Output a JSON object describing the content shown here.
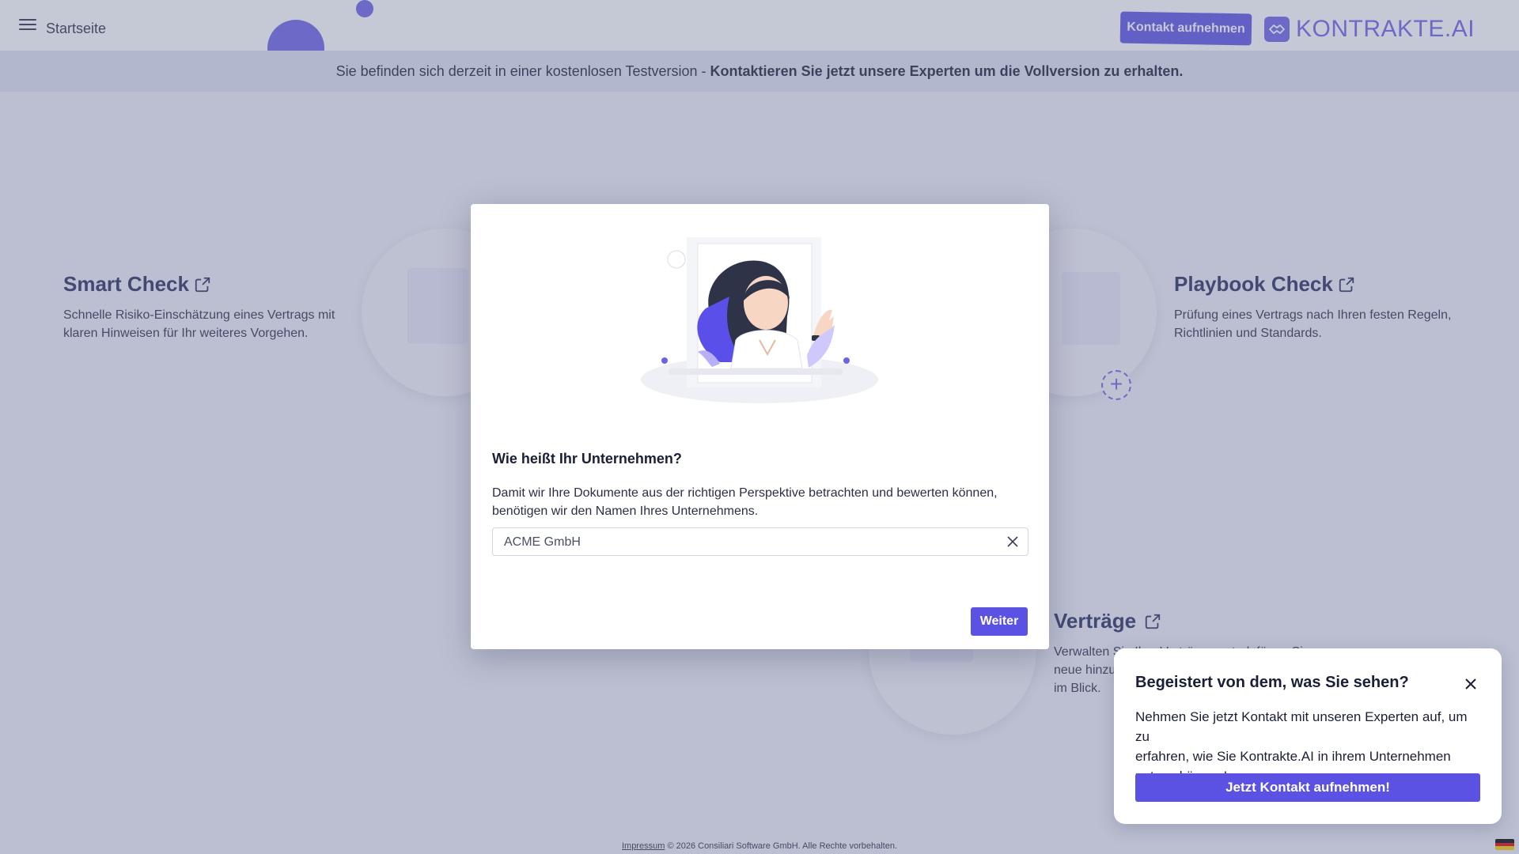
{
  "header": {
    "home_label": "Startseite",
    "contact_button": "Kontakt aufnehmen",
    "logo_text": "KONTRAKTE.AI"
  },
  "banner": {
    "text": "Sie befinden sich derzeit in einer kostenlosen Testversion - ",
    "bold_text": "Kontaktieren Sie jetzt unsere Experten um die Vollversion zu erhalten."
  },
  "features": {
    "smart_check": {
      "title": "Smart Check",
      "desc_line1": "Schnelle Risiko-Einschätzung eines Vertrags mit",
      "desc_line2": "klaren Hinweisen für Ihr weiteres Vorgehen."
    },
    "playbook_check": {
      "title": "Playbook Check",
      "desc_line1": "Prüfung eines Vertrags nach Ihren festen Regeln,",
      "desc_line2": "Richtlinien und Standards."
    },
    "vertraege": {
      "title": "Verträge",
      "desc_line1": "Verwalten Sie Ihre Verträge zentral, fügen Sie",
      "desc_line2": "neue hinzu",
      "desc_line3": "im Blick."
    }
  },
  "modal": {
    "title": "Wie heißt Ihr Unternehmen?",
    "desc_line1": "Damit wir Ihre Dokumente aus der richtigen Perspektive betrachten und bewerten können,",
    "desc_line2": "benötigen wir den Namen Ihres Unternehmens.",
    "company_value": "ACME GmbH",
    "next_button": "Weiter"
  },
  "toast": {
    "title": "Begeistert von dem, was Sie sehen?",
    "text_line1": "Nehmen Sie jetzt Kontakt mit unseren Experten auf, um zu",
    "text_line2": "erfahren, wie Sie Kontrakte.AI in ihrem Unternehmen",
    "text_line3": "nutzen können!",
    "cta_button": "Jetzt Kontakt aufnehmen!"
  },
  "footer": {
    "impressum": "Impressum",
    "copyright": "© 2026 Consiliari Software GmbH. Alle Rechte vorbehalten."
  },
  "colors": {
    "accent": "#5b52e4",
    "brand": "#6b63e6",
    "title": "#262c5c"
  },
  "icons": {
    "menu": "menu-icon",
    "logo": "handshake-icon",
    "external": "external-link-icon",
    "close": "close-icon",
    "plus": "plus-icon",
    "flag": "german-flag-icon"
  }
}
